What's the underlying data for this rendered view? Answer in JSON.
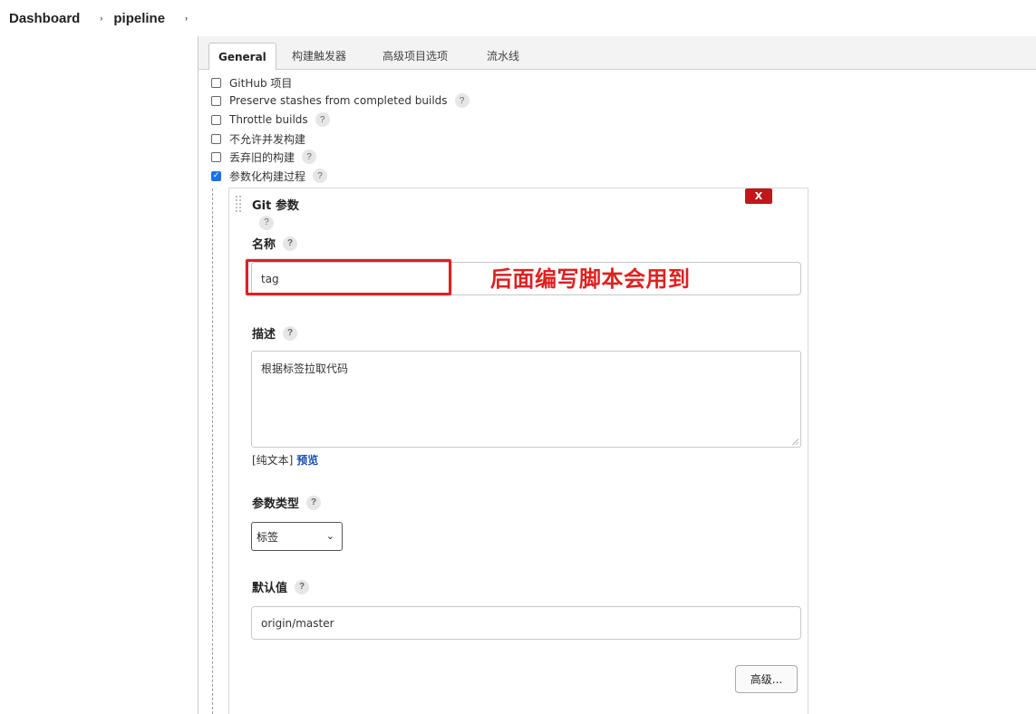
{
  "breadcrumb": {
    "items": [
      "Dashboard",
      "pipeline"
    ],
    "sep": "›"
  },
  "tabs": [
    "General",
    "构建触发器",
    "高级项目选项",
    "流水线"
  ],
  "options": [
    {
      "label": "GitHub 项目",
      "checked": false,
      "help": false
    },
    {
      "label": "Preserve stashes from completed builds",
      "checked": false,
      "help": true
    },
    {
      "label": "Throttle builds",
      "checked": false,
      "help": true
    },
    {
      "label": "不允许并发构建",
      "checked": false,
      "help": false
    },
    {
      "label": "丢弃旧的构建",
      "checked": false,
      "help": true
    },
    {
      "label": "参数化构建过程",
      "checked": true,
      "help": true
    }
  ],
  "help_mark": "?",
  "check_mark": "✓",
  "param": {
    "title": "Git 参数",
    "delete_label": "X",
    "name_label": "名称",
    "name_value": "tag",
    "desc_label": "描述",
    "desc_value": "根据标签拉取代码",
    "format_prefix": "[纯文本]",
    "preview_link": "预览",
    "type_label": "参数类型",
    "type_value": "标签",
    "type_chevron": "⌄",
    "default_label": "默认值",
    "default_value": "origin/master",
    "advanced_button": "高级..."
  },
  "annotation": "后面编写脚本会用到",
  "colors": {
    "annotation": "#e02020",
    "delete_bg": "#c0181a",
    "link": "#1a4fb0",
    "checkbox": "#1a73e8"
  }
}
